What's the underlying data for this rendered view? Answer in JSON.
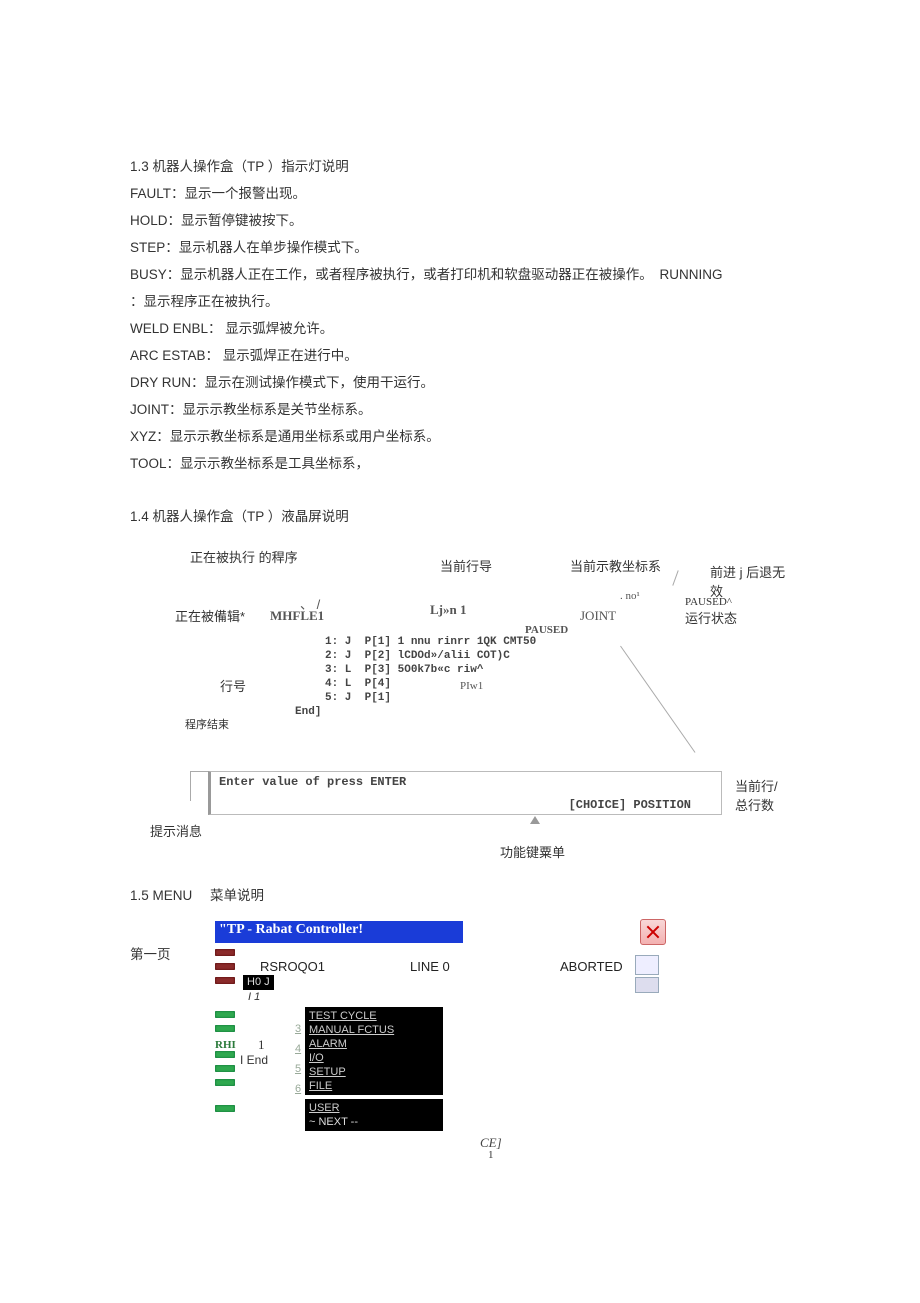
{
  "section13": {
    "title": "1.3 机器人操作盒（TP ）指示灯说明",
    "items": [
      "FAULT：显示一个报警出现。",
      "HOLD：显示暂停键被按下。",
      "STEP：显示机器人在单步操作模式下。",
      "BUSY：显示机器人正在工作，或者程序被执行，或者打印机和软盘驱动器正在被操作。　RUNNING",
      "：显示程序正在被执行。",
      "WELD ENBL：  显示弧焊被允许。",
      "ARC ESTAB：  显示弧焊正在进行中。",
      "DRY RUN：显示在测试操作模式下，使用干运行。",
      "JOINT：显示示教坐标系是关节坐标系。",
      "XYZ：显示示教坐标系是通用坐标系或用户坐标系。",
      "TOOL：显示示教坐标系是工具坐标系，"
    ]
  },
  "section14": {
    "title": "1.4 机器人操作盒（TP ）液晶屏说明",
    "labels": {
      "exec_prog": "正在被执行 的稈序",
      "cur_line_nav": "当前行导",
      "cur_coord": "当前示教坐标系",
      "fwd_back": "前进 j 后退无效",
      "editing": "正在被備辑*",
      "mhfle": "MHFLE1",
      "ljn": "Lj»n 1",
      "no": ". no¹",
      "paused_caret": "PAUSED^",
      "joint": "JOINT",
      "run_state": "运行状态",
      "paused": "PAUSED",
      "line_no": "行号",
      "prog_end": "程序结束",
      "cur_total": "当前行/总行数",
      "hint_msg": "提示消息",
      "func_menu": "功能键粟单",
      "prompt": "Enter value of press ENTER",
      "choice": "[CHOICE] POSITION",
      "code1": "1: J  P[1] 1 nnu rinrr 1QK CMT50",
      "code2": "2: J  P[2] lCDOd»/alii COT)C",
      "code3": "3: L  P[3] 5O0k7b«c riw^",
      "code4": "4: L  P[4]",
      "code5": "5: J  P[1]",
      "code6": "End]",
      "piw": "PIw1",
      "slash": "、 /"
    }
  },
  "section15": {
    "title_left": "1.5 MENU",
    "title_right": "菜单说明",
    "page1": "第一页",
    "bluebar": "\"TP - Rabat Controller!",
    "status": {
      "prog": "RSROQO1",
      "line": "LINE 0",
      "state": "ABORTED"
    },
    "small1": "H0 J",
    "small2": "I 1",
    "rhi": "RHI",
    "one": "1",
    "iend": "I End",
    "menu_items": [
      "TEST CYCLE",
      "MANUAL FCTUS",
      "ALARM",
      "I/O",
      "SETUP",
      "FILE"
    ],
    "menu_nums": [
      "3",
      "4",
      "5",
      "6"
    ],
    "menu_tail1": "USER",
    "menu_tail2": "~ NEXT --",
    "ce": "CE]",
    "pg": "1"
  }
}
